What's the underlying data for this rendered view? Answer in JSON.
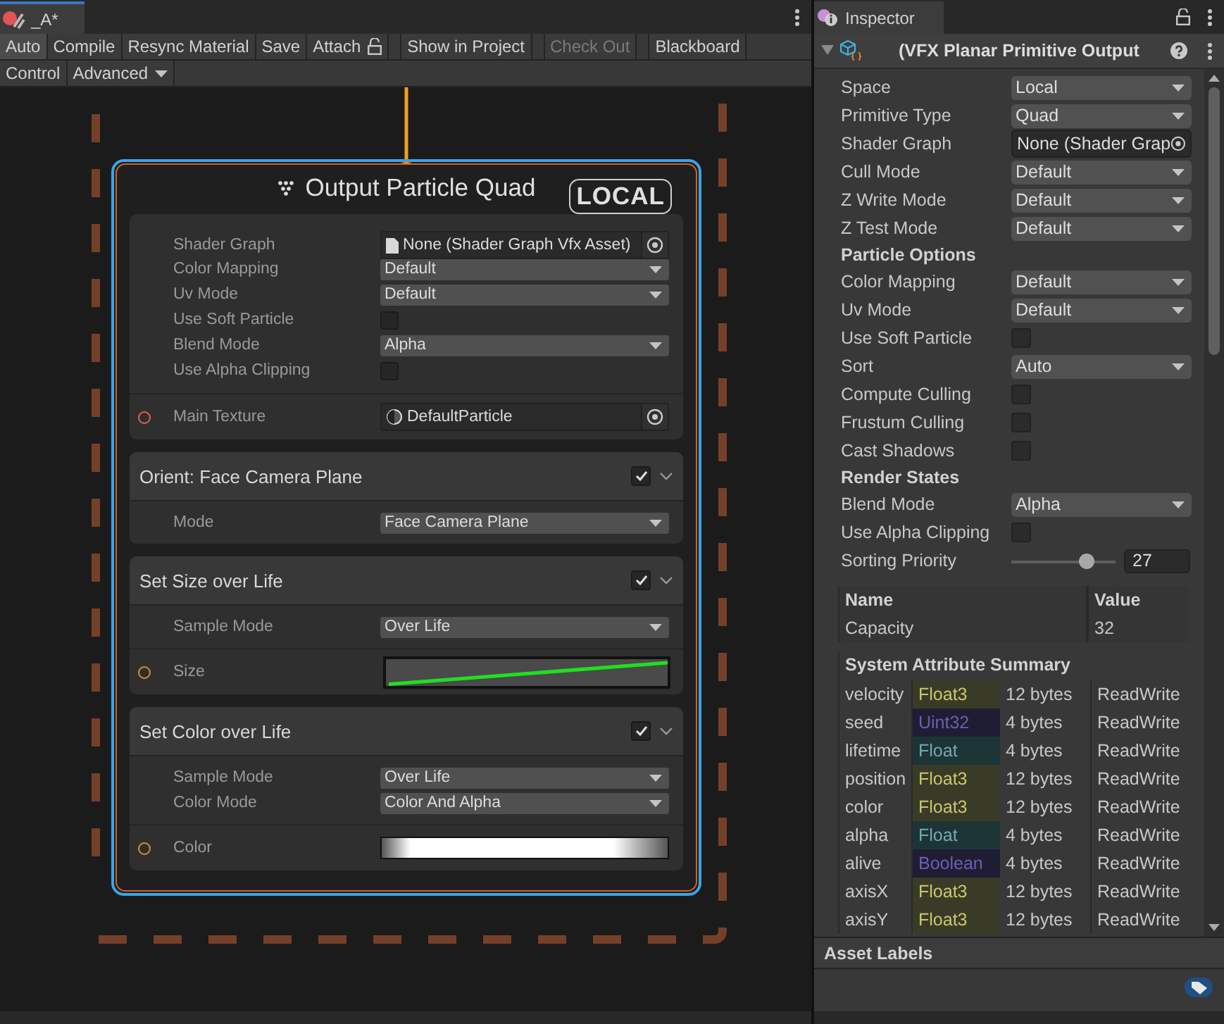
{
  "editor_tab": {
    "title": "_A*"
  },
  "toolbar_rows": [
    [
      {
        "label": "Auto",
        "kind": "toggle",
        "on": true,
        "disabled": false
      },
      {
        "label": "Compile",
        "kind": "button",
        "on": false,
        "disabled": false
      },
      {
        "label": "Resync Material",
        "kind": "button",
        "on": false,
        "disabled": false
      },
      {
        "label": "Save",
        "kind": "button",
        "on": false,
        "disabled": false
      },
      {
        "label": "Attach",
        "kind": "attach",
        "on": false,
        "disabled": false
      },
      {
        "label": "Show in Project",
        "kind": "button",
        "on": false,
        "disabled": false
      },
      {
        "label": "Check Out",
        "kind": "button",
        "on": false,
        "disabled": true
      },
      {
        "label": "Blackboard",
        "kind": "toggle",
        "on": false,
        "disabled": false
      }
    ],
    [
      {
        "label": "Control",
        "kind": "toggle",
        "on": false,
        "disabled": false
      },
      {
        "label": "Advanced",
        "kind": "menu",
        "on": false,
        "disabled": false
      }
    ]
  ],
  "node": {
    "title": "Output Particle Quad",
    "badge": "LOCAL",
    "settings": [
      {
        "label": "Shader Graph",
        "kind": "object",
        "value": "None (Shader Graph Vfx Asset)"
      },
      {
        "label": "Color Mapping",
        "kind": "dropdown",
        "value": "Default"
      },
      {
        "label": "Uv Mode",
        "kind": "dropdown",
        "value": "Default"
      },
      {
        "label": "Use Soft Particle",
        "kind": "checkbox",
        "checked": false
      },
      {
        "label": "Blend Mode",
        "kind": "dropdown",
        "value": "Alpha"
      },
      {
        "label": "Use Alpha Clipping",
        "kind": "checkbox",
        "checked": false
      }
    ],
    "ports": [
      {
        "label": "Main Texture",
        "kind": "texture",
        "value": "DefaultParticle",
        "color": "#e06060"
      }
    ],
    "blocks": [
      {
        "title": "Orient: Face Camera Plane",
        "enabled": true,
        "expanded": true,
        "settings": [
          {
            "label": "Mode",
            "kind": "dropdown",
            "value": "Face Camera Plane"
          }
        ]
      },
      {
        "title": "Set Size over Life",
        "enabled": true,
        "expanded": true,
        "settings": [
          {
            "label": "Sample Mode",
            "kind": "dropdown",
            "value": "Over Life"
          }
        ],
        "ports": [
          {
            "label": "Size",
            "kind": "curve",
            "color": "#e08a30"
          }
        ]
      },
      {
        "title": "Set Color over Life",
        "enabled": true,
        "expanded": true,
        "settings": [
          {
            "label": "Sample Mode",
            "kind": "dropdown",
            "value": "Over Life"
          },
          {
            "label": "Color Mode",
            "kind": "dropdown",
            "value": "Color And Alpha"
          }
        ],
        "ports": [
          {
            "label": "Color",
            "kind": "gradient",
            "color": "#e08a30"
          }
        ]
      }
    ]
  },
  "inspector": {
    "tab": "Inspector",
    "component": {
      "title": "(VFX Planar Primitive Output",
      "expanded": true
    },
    "properties": [
      {
        "kind": "dropdown",
        "label": "Space",
        "value": "Local"
      },
      {
        "kind": "dropdown",
        "label": "Primitive Type",
        "value": "Quad"
      },
      {
        "kind": "object",
        "label": "Shader Graph",
        "value": "None (Shader Grap"
      },
      {
        "kind": "dropdown",
        "label": "Cull Mode",
        "value": "Default"
      },
      {
        "kind": "dropdown",
        "label": "Z Write Mode",
        "value": "Default"
      },
      {
        "kind": "dropdown",
        "label": "Z Test Mode",
        "value": "Default"
      },
      {
        "kind": "header",
        "label": "Particle Options"
      },
      {
        "kind": "dropdown",
        "label": "Color Mapping",
        "value": "Default"
      },
      {
        "kind": "dropdown",
        "label": "Uv Mode",
        "value": "Default"
      },
      {
        "kind": "checkbox",
        "label": "Use Soft Particle",
        "checked": false
      },
      {
        "kind": "dropdown",
        "label": "Sort",
        "value": "Auto"
      },
      {
        "kind": "checkbox",
        "label": "Compute Culling",
        "checked": false
      },
      {
        "kind": "checkbox",
        "label": "Frustum Culling",
        "checked": false
      },
      {
        "kind": "checkbox",
        "label": "Cast Shadows",
        "checked": false
      },
      {
        "kind": "header",
        "label": "Render States"
      },
      {
        "kind": "dropdown",
        "label": "Blend Mode",
        "value": "Alpha"
      },
      {
        "kind": "checkbox",
        "label": "Use Alpha Clipping",
        "checked": false
      },
      {
        "kind": "slider",
        "label": "Sorting Priority",
        "level": 0.72,
        "value": "27"
      }
    ],
    "parameters": {
      "columns": [
        "Name",
        "Value"
      ],
      "rows": [
        [
          "Capacity",
          "32"
        ]
      ]
    },
    "attribute_summary": {
      "title": "System Attribute Summary",
      "rows": [
        {
          "name": "velocity",
          "type": "Float3",
          "kind": "float3",
          "size": "12 bytes",
          "access": "ReadWrite"
        },
        {
          "name": "seed",
          "type": "Uint32",
          "kind": "uint",
          "size": "4 bytes",
          "access": "ReadWrite"
        },
        {
          "name": "lifetime",
          "type": "Float",
          "kind": "float",
          "size": "4 bytes",
          "access": "ReadWrite"
        },
        {
          "name": "position",
          "type": "Float3",
          "kind": "float3",
          "size": "12 bytes",
          "access": "ReadWrite"
        },
        {
          "name": "color",
          "type": "Float3",
          "kind": "float3",
          "size": "12 bytes",
          "access": "ReadWrite"
        },
        {
          "name": "alpha",
          "type": "Float",
          "kind": "float",
          "size": "4 bytes",
          "access": "ReadWrite"
        },
        {
          "name": "alive",
          "type": "Boolean",
          "kind": "bool",
          "size": "4 bytes",
          "access": "ReadWrite"
        },
        {
          "name": "axisX",
          "type": "Float3",
          "kind": "float3",
          "size": "12 bytes",
          "access": "ReadWrite"
        },
        {
          "name": "axisY",
          "type": "Float3",
          "kind": "float3",
          "size": "12 bytes",
          "access": "ReadWrite"
        }
      ]
    },
    "asset_labels": {
      "title": "Asset Labels"
    }
  }
}
